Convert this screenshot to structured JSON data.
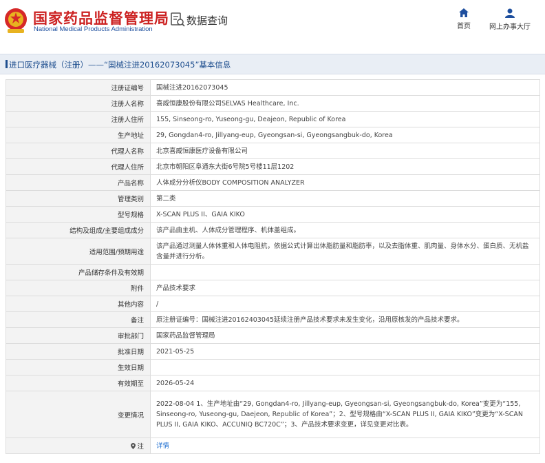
{
  "header": {
    "org_cn": "国家药品监督管理局",
    "org_en": "National Medical Products Administration",
    "section_title": "数据查询",
    "nav": [
      {
        "label": "首页",
        "icon": "home-icon"
      },
      {
        "label": "网上办事大厅",
        "icon": "user-icon"
      }
    ]
  },
  "breadcrumb": "进口医疗器械（注册）——“国械注进20162073045”基本信息",
  "details": [
    {
      "key": "注册证编号",
      "value": "国械注进20162073045"
    },
    {
      "key": "注册人名称",
      "value": "喜威恒康股份有限公司SELVAS Healthcare, Inc."
    },
    {
      "key": "注册人住所",
      "value": "155, Sinseong-ro, Yuseong-gu, Deajeon, Republic of Korea"
    },
    {
      "key": "生产地址",
      "value": "29, Gongdan4-ro, Jillyang-eup, Gyeongsan-si, Gyeongsangbuk-do, Korea"
    },
    {
      "key": "代理人名称",
      "value": "北京喜威恒康医疗设备有限公司"
    },
    {
      "key": "代理人住所",
      "value": "北京市朝阳区阜通东大街6号院5号楼11层1202"
    },
    {
      "key": "产品名称",
      "value": "人体成分分析仪BODY COMPOSITION ANALYZER"
    },
    {
      "key": "管理类别",
      "value": "第二类"
    },
    {
      "key": "型号规格",
      "value": "X-SCAN PLUS II、GAIA KIKO"
    },
    {
      "key": "结构及组成/主要组成成分",
      "value": "该产品由主机、人体成分管理程序、机体盖组成。"
    },
    {
      "key": "适用范围/预期用途",
      "value": "该产品通过测量人体体重和人体电阻抗，依据公式计算出体脂肪量和脂肪率，以及去脂体重、肌肉量、身体水分、蛋白质、无机盐含量并进行分析。"
    },
    {
      "key": "产品储存条件及有效期",
      "value": ""
    },
    {
      "key": "附件",
      "value": "产品技术要求"
    },
    {
      "key": "其他内容",
      "value": "/"
    },
    {
      "key": "备注",
      "value": "原注册证编号：国械注进20162403045延续注册产品技术要求未发生变化，沿用原核发的产品技术要求。"
    },
    {
      "key": "审批部门",
      "value": "国家药品监督管理局"
    },
    {
      "key": "批准日期",
      "value": "2021-05-25"
    },
    {
      "key": "生效日期",
      "value": ""
    },
    {
      "key": "有效期至",
      "value": "2026-05-24"
    },
    {
      "key": "变更情况",
      "value": "2022-08-04 1、生产地址由“29, Gongdan4-ro, Jillyang-eup, Gyeongsan-si, Gyeongsangbuk-do, Korea”变更为“155, Sinseong-ro, Yuseong-gu, Daejeon, Republic of Korea”；2、型号规格由“X-SCAN PLUS II, GAIA KIKO”变更为“X-SCAN PLUS II, GAIA KIKO、ACCUNIQ BC720C”；3、产品技术要求变更，详见变更对比表。"
    }
  ],
  "note_row": {
    "key": "注",
    "link": "详情"
  }
}
